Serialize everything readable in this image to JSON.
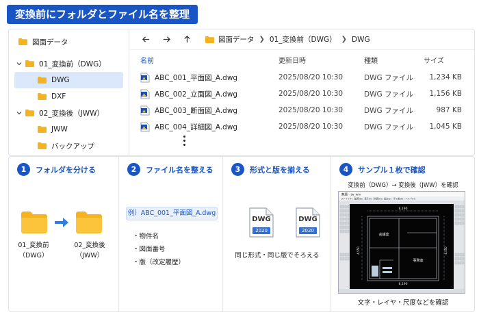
{
  "page_title": "変換前にフォルダとファイル名を整理",
  "explorer": {
    "tree": [
      {
        "label": "図面データ",
        "level": 0,
        "chevron": "none",
        "selected": false
      },
      {
        "label": "01_変換前（DWG）",
        "level": 1,
        "chevron": "down",
        "selected": false
      },
      {
        "label": "DWG",
        "level": 2,
        "chevron": "none",
        "selected": true
      },
      {
        "label": "DXF",
        "level": 2,
        "chevron": "none",
        "selected": false
      },
      {
        "label": "02_変換後（JWW）",
        "level": 1,
        "chevron": "down",
        "selected": false
      },
      {
        "label": "JWW",
        "level": 2,
        "chevron": "none",
        "selected": false
      },
      {
        "label": "バックアップ",
        "level": 2,
        "chevron": "none",
        "selected": false
      }
    ],
    "breadcrumb": [
      "図面データ",
      "01_変換前（DWG）",
      "DWG"
    ],
    "columns": {
      "name": "名前",
      "date": "更新日時",
      "type": "種類",
      "size": "サイズ"
    },
    "files": [
      {
        "name": "ABC_001_平面図_A.dwg",
        "date": "2025/08/20 10:30",
        "type": "DWG ファイル",
        "size": "1,234 KB"
      },
      {
        "name": "ABC_002_立面図_A.dwg",
        "date": "2025/08/20 10:30",
        "type": "DWG ファイル",
        "size": "1,156 KB"
      },
      {
        "name": "ABC_003_断面図_A.dwg",
        "date": "2025/08/20 10:30",
        "type": "DWG ファイル",
        "size": "987 KB"
      },
      {
        "name": "ABC_004_詳細図_A.dwg",
        "date": "2025/08/20 10:30",
        "type": "DWG ファイル",
        "size": "1,045 KB"
      }
    ]
  },
  "steps": [
    {
      "num": "1",
      "title": "フォルダを分ける",
      "from_label": "01_変換前\n（DWG）",
      "to_label": "02_変換後\n（JWW）"
    },
    {
      "num": "2",
      "title": "ファイル名を整える",
      "example": "例）ABC_001_平面図_A.dwg",
      "bullets": [
        "物件名",
        "図面番号",
        "版（改定履歴）"
      ]
    },
    {
      "num": "3",
      "title": "形式と版を揃える",
      "doc_format": "DWG",
      "doc_version": "2020",
      "caption": "同じ形式・同じ版でそろえる"
    },
    {
      "num": "4",
      "title": "サンプル１枚で確認",
      "subtitle": "変換前（DWG）→ 変換後（JWW）を確認",
      "caption": "文字・レイヤ・尺度などを確認",
      "window_title": "無題 - jw_win",
      "menu": "ファイル(F)［編集(E)］表示(V)［作図(D)］設定(S)［その他(A)］ヘルプ(H)",
      "dim_label": "8,190",
      "side_dim": "4,550",
      "room1": "会議室",
      "room2": "事務室"
    }
  ],
  "colors": {
    "accent": "#1a55c4",
    "folder": "#f5b321",
    "selected": "#dbe8fb",
    "cad_bg": "#050505"
  }
}
